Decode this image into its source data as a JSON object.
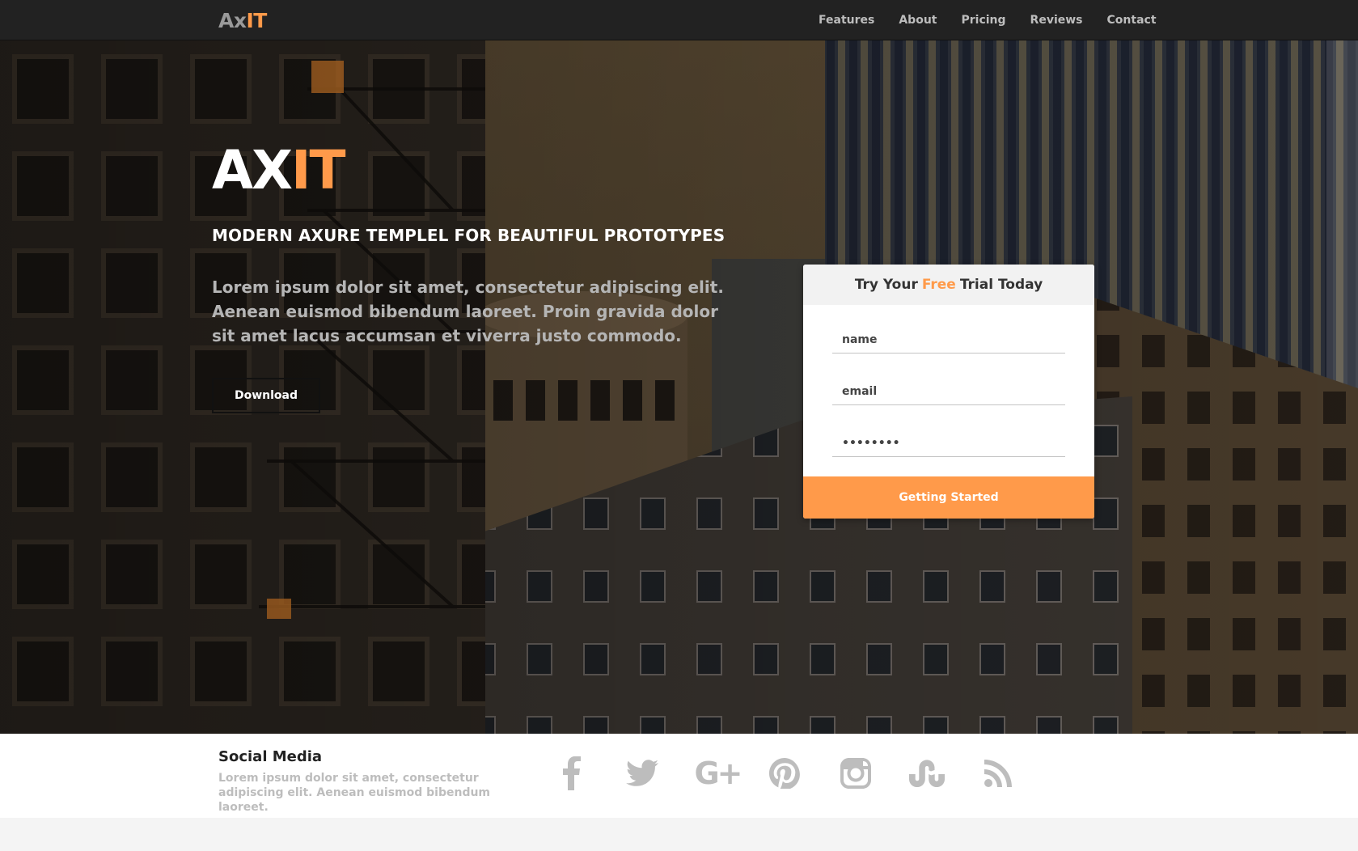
{
  "nav": {
    "logo_part1": "Ax",
    "logo_part2": "IT",
    "links": [
      "Features",
      "About",
      "Pricing",
      "Reviews",
      "Contact"
    ]
  },
  "hero": {
    "logo_part1": "AX",
    "logo_part2": "IT",
    "tagline": "MODERN AXURE TEMPLEL FOR BEAUTIFUL PROTOTYPES",
    "description": "Lorem ipsum dolor sit amet, consectetur adipiscing elit. Aenean euismod bibendum laoreet. Proin gravida dolor sit amet lacus accumsan et viverra justo commodo.",
    "download_label": "Download"
  },
  "signup": {
    "title_before": "Try Your",
    "title_highlight": "Free",
    "title_after": "Trial Today",
    "name_placeholder": "name",
    "email_placeholder": "email",
    "password_value": "••••••••",
    "submit_label": "Getting Started"
  },
  "social": {
    "title": "Social Media",
    "description": "Lorem ipsum dolor sit amet, consectetur adipiscing elit. Aenean euismod bibendum laoreet.",
    "icons": [
      "facebook-icon",
      "twitter-icon",
      "google-plus-icon",
      "pinterest-icon",
      "instagram-icon",
      "stumbleupon-icon",
      "rss-icon"
    ],
    "google_plus_glyph": "G+"
  },
  "colors": {
    "accent": "#ff9a4a",
    "navbar": "#222222",
    "icon_gray": "#bdbdbd"
  }
}
